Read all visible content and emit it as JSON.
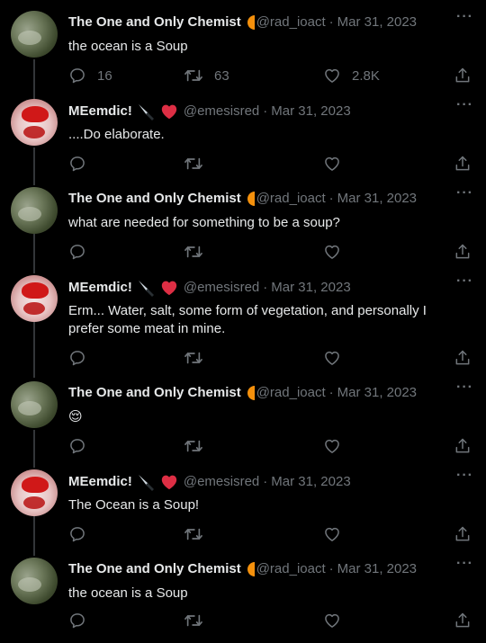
{
  "tweets": [
    {
      "author": "The One and Only Chemist",
      "handle": "@rad_ioact",
      "date": "Mar 31, 2023",
      "text": "the ocean is a Soup",
      "replies": "16",
      "retweets": "63",
      "likes": "2.8K",
      "avatar": "chemist"
    },
    {
      "author": "MEemdic!",
      "handle": "@emesisred",
      "date": "Mar 31, 2023",
      "text": "....Do elaborate.",
      "replies": "",
      "retweets": "",
      "likes": "",
      "avatar": "meemdic"
    },
    {
      "author": "The One and Only Chemist",
      "handle": "@rad_ioact",
      "date": "Mar 31, 2023",
      "text": "what are needed for something to be a soup?",
      "replies": "",
      "retweets": "",
      "likes": "",
      "avatar": "chemist"
    },
    {
      "author": "MEemdic!",
      "handle": "@emesisred",
      "date": "Mar 31, 2023",
      "text": "Erm... Water, salt, some form of vegetation, and personally I prefer some meat in mine.",
      "replies": "",
      "retweets": "",
      "likes": "",
      "avatar": "meemdic"
    },
    {
      "author": "The One and Only Chemist",
      "handle": "@rad_ioact",
      "date": "Mar 31, 2023",
      "text": "😌",
      "replies": "",
      "retweets": "",
      "likes": "",
      "avatar": "chemist"
    },
    {
      "author": "MEemdic!",
      "handle": "@emesisred",
      "date": "Mar 31, 2023",
      "text": "The Ocean is a Soup!",
      "replies": "",
      "retweets": "",
      "likes": "",
      "avatar": "meemdic"
    },
    {
      "author": "The One and Only Chemist",
      "handle": "@rad_ioact",
      "date": "Mar 31, 2023",
      "text": "the ocean is a Soup",
      "replies": "",
      "retweets": "",
      "likes": "",
      "avatar": "chemist"
    }
  ],
  "separator_dot": "·",
  "more_glyph": "···",
  "icons": {
    "chemist_badge": "radioactive-half-circle-icon",
    "meemdic_badges": [
      "knife-icon",
      "red-heart-icon"
    ],
    "reply": "reply-icon",
    "retweet": "retweet-icon",
    "like": "like-icon",
    "share": "share-icon",
    "more": "more-icon"
  },
  "colors": {
    "background": "#000000",
    "text": "#e7e9ea",
    "secondary": "#71767b",
    "thread_line": "#333639",
    "badge_orange": "#f4900c",
    "heart_red": "#dd2e44"
  }
}
